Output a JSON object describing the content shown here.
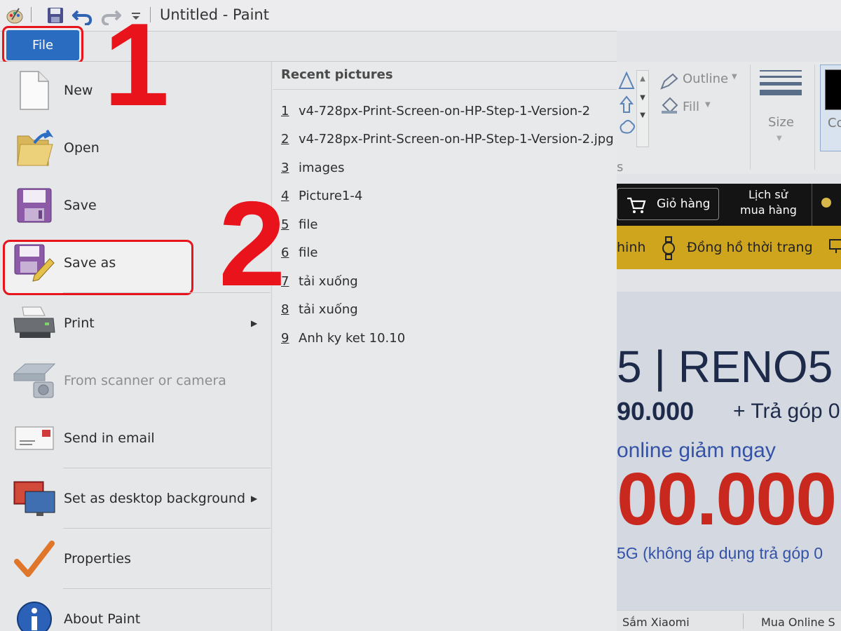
{
  "window": {
    "title": "Untitled - Paint"
  },
  "file_tab": {
    "label": "File"
  },
  "steps": {
    "one": "1",
    "two": "2"
  },
  "menu": {
    "items": [
      {
        "label": "New",
        "icon": "new-file-icon"
      },
      {
        "label": "Open",
        "icon": "open-folder-icon"
      },
      {
        "label": "Save",
        "icon": "save-disk-icon"
      },
      {
        "label": "Save as",
        "icon": "save-as-icon"
      },
      {
        "label": "Print",
        "icon": "printer-icon"
      },
      {
        "label": "From scanner or camera",
        "icon": "scanner-icon"
      },
      {
        "label": "Send in email",
        "icon": "email-icon"
      },
      {
        "label": "Set as desktop background",
        "icon": "desktop-background-icon"
      },
      {
        "label": "Properties",
        "icon": "checkmark-icon"
      },
      {
        "label": "About Paint",
        "icon": "info-icon"
      }
    ]
  },
  "recent": {
    "heading": "Recent pictures",
    "items": [
      {
        "num": "1",
        "name": "v4-728px-Print-Screen-on-HP-Step-1-Version-2"
      },
      {
        "num": "2",
        "name": "v4-728px-Print-Screen-on-HP-Step-1-Version-2.jpg"
      },
      {
        "num": "3",
        "name": "images"
      },
      {
        "num": "4",
        "name": "Picture1-4"
      },
      {
        "num": "5",
        "name": "file"
      },
      {
        "num": "6",
        "name": "file"
      },
      {
        "num": "7",
        "name": "tải xuống"
      },
      {
        "num": "8",
        "name": "tải xuống"
      },
      {
        "num": "9",
        "name": "Anh ky ket 10.10"
      }
    ]
  },
  "ribbon": {
    "outline": "Outline",
    "fill": "Fill",
    "size": "Size",
    "colors_partial": "Co",
    "shapes_partial": "s"
  },
  "web": {
    "cart": "Giỏ hàng",
    "history_line1": "Lịch sử",
    "history_line2": "mua hàng",
    "yellow_left": "hinh",
    "yellow_item": "Đồng hồ thời trang",
    "banner_line1": "5 | RENO5",
    "banner_line2": "90.000",
    "banner_line2b": "+ Trả góp 0",
    "banner_line3": "online giảm ngay",
    "banner_line4": "00.000",
    "banner_line5": "5G (không áp dụng trả góp 0",
    "bottom_left": "Sắm Xiaomi",
    "bottom_right": "Mua Online S"
  },
  "colors": {
    "accent_blue": "#2a6cc0",
    "highlight_red": "#e8131b"
  }
}
